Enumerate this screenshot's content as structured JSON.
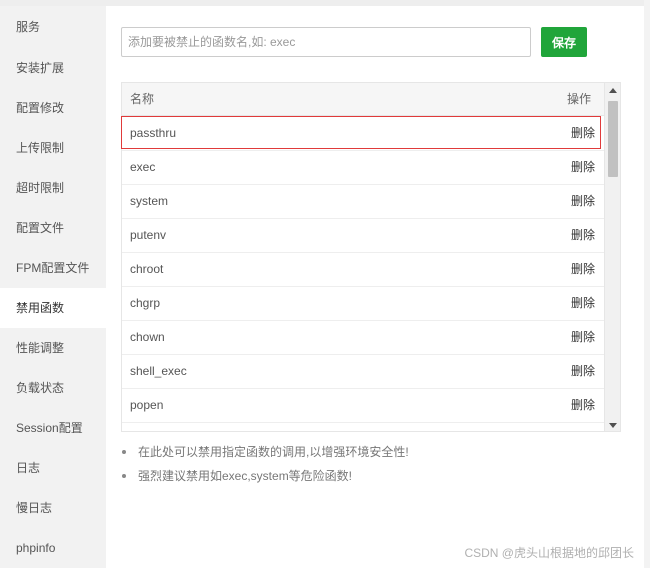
{
  "sidebar": {
    "items": [
      {
        "label": "服务"
      },
      {
        "label": "安装扩展"
      },
      {
        "label": "配置修改"
      },
      {
        "label": "上传限制"
      },
      {
        "label": "超时限制"
      },
      {
        "label": "配置文件"
      },
      {
        "label": "FPM配置文件"
      },
      {
        "label": "禁用函数",
        "active": true
      },
      {
        "label": "性能调整"
      },
      {
        "label": "负载状态"
      },
      {
        "label": "Session配置"
      },
      {
        "label": "日志"
      },
      {
        "label": "慢日志"
      },
      {
        "label": "phpinfo"
      }
    ]
  },
  "form": {
    "input_placeholder": "添加要被禁止的函数名,如: exec",
    "input_value": "",
    "save_label": "保存"
  },
  "table": {
    "col_name": "名称",
    "col_op": "操作",
    "rows": [
      {
        "name": "passthru",
        "action": "删除"
      },
      {
        "name": "exec",
        "action": "删除"
      },
      {
        "name": "system",
        "action": "删除"
      },
      {
        "name": "putenv",
        "action": "删除"
      },
      {
        "name": "chroot",
        "action": "删除"
      },
      {
        "name": "chgrp",
        "action": "删除"
      },
      {
        "name": "chown",
        "action": "删除"
      },
      {
        "name": "shell_exec",
        "action": "删除"
      },
      {
        "name": "popen",
        "action": "删除"
      },
      {
        "name": "",
        "action": ""
      }
    ]
  },
  "tips": [
    "在此处可以禁用指定函数的调用,以增强环境安全性!",
    "强烈建议禁用如exec,system等危险函数!"
  ],
  "watermark": "CSDN @虎头山根据地的邱团长",
  "colors": {
    "accent": "#20a53a",
    "highlight": "#e03a3a",
    "sidebar_bg": "#f2f2f2"
  }
}
